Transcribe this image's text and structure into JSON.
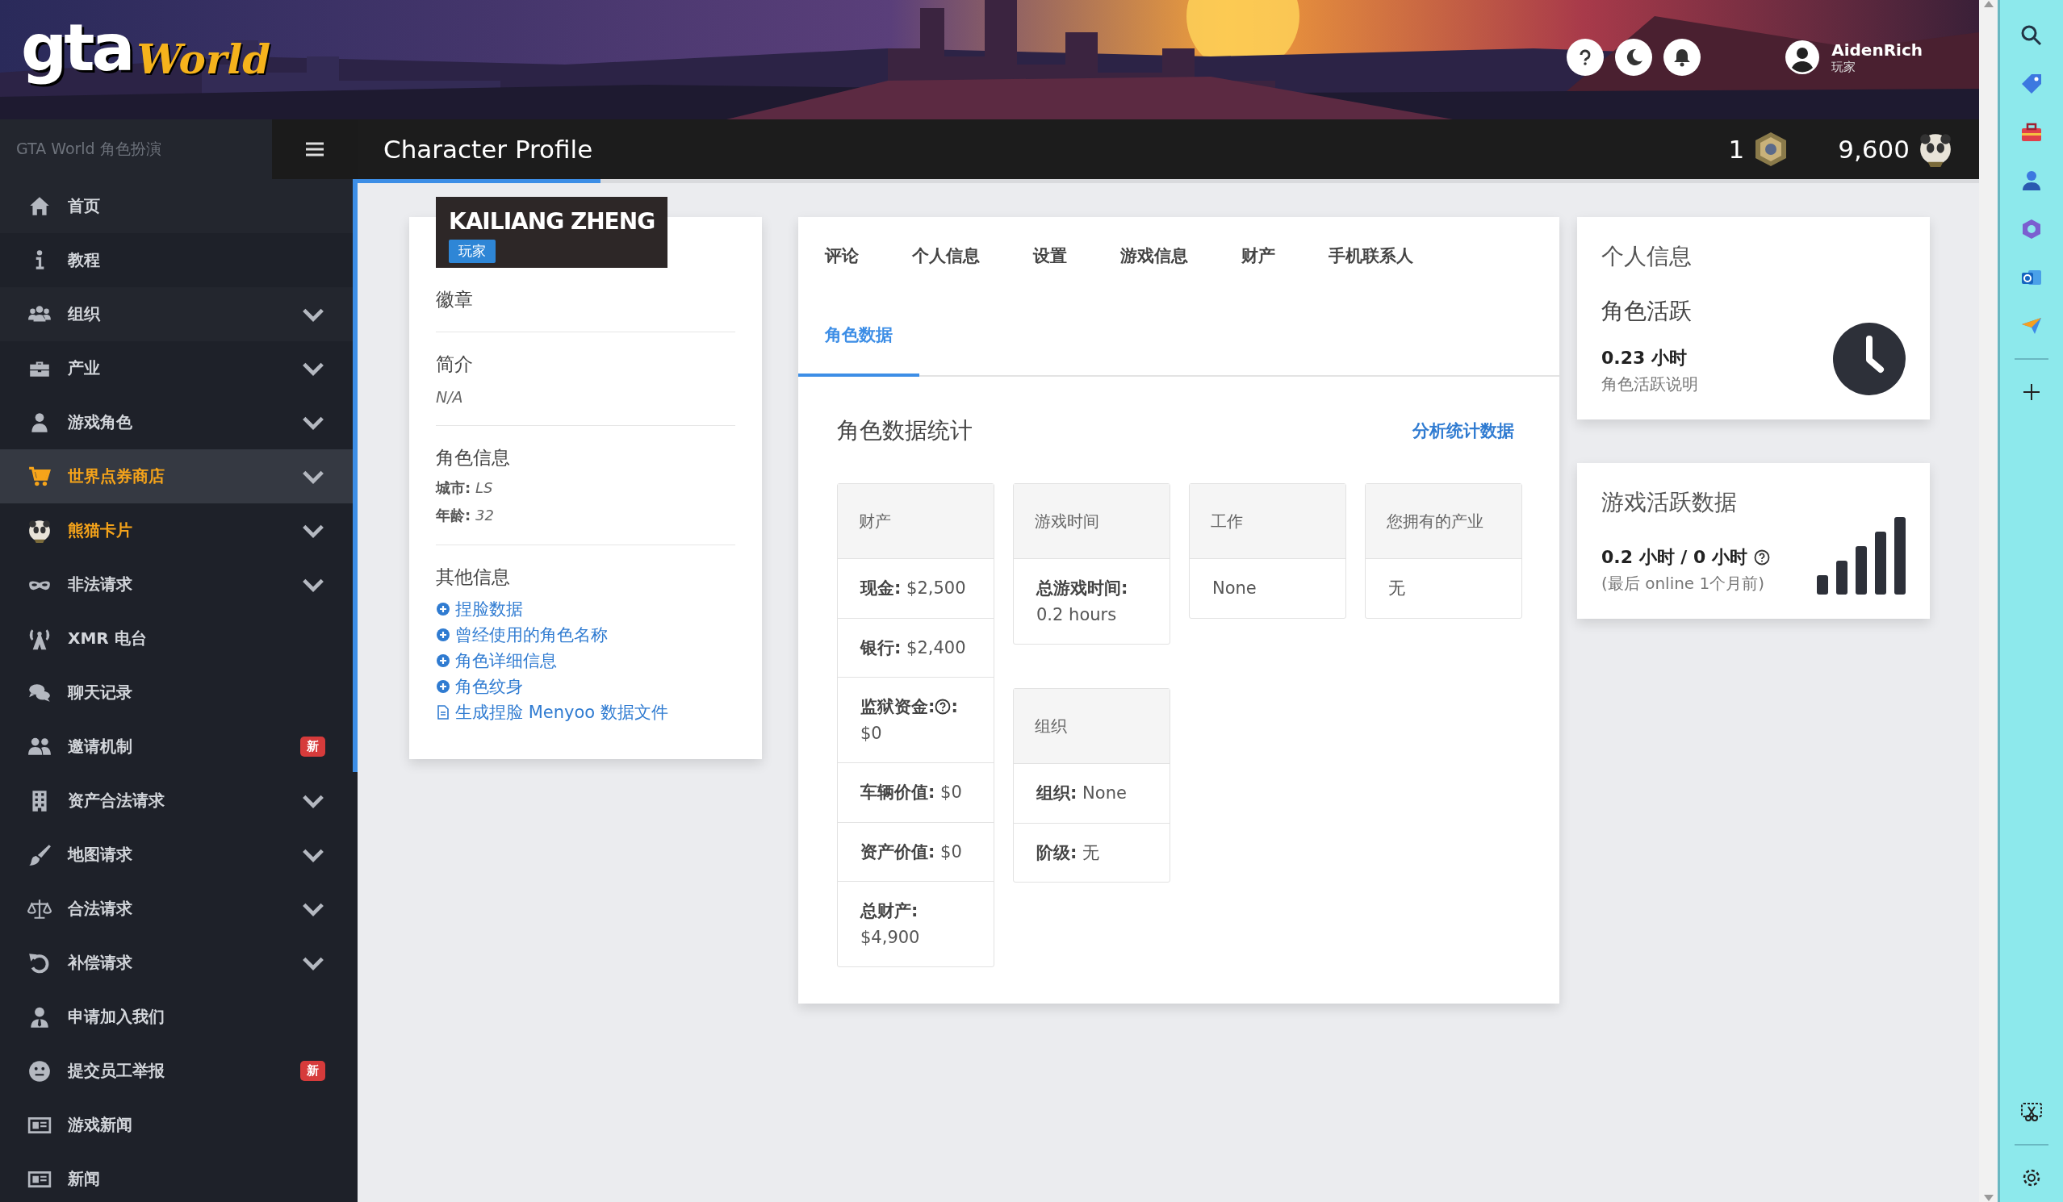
{
  "banner": {
    "logo": {
      "part_1": "gta",
      "part_2": "World"
    },
    "user": {
      "name": "AidenRich",
      "role": "玩家"
    }
  },
  "topbar": {
    "brand": "GTA World 角色扮演",
    "title": "Character Profile",
    "counters": [
      {
        "value": "1"
      },
      {
        "value": "9,600"
      }
    ],
    "loading_bar": {
      "level": 0.15
    }
  },
  "sidebar": {
    "items": [
      {
        "label": "首页",
        "expandable": false,
        "accent": false,
        "selected": false
      },
      {
        "label": "教程",
        "expandable": false,
        "accent": false,
        "selected": false
      },
      {
        "label": "组织",
        "expandable": true,
        "accent": false,
        "selected": false
      },
      {
        "label": "产业",
        "expandable": true,
        "accent": false,
        "selected": false
      },
      {
        "label": "游戏角色",
        "expandable": true,
        "accent": false,
        "selected": false
      },
      {
        "label": "世界点券商店",
        "expandable": true,
        "accent": true,
        "selected": true
      },
      {
        "label": "熊猫卡片",
        "expandable": true,
        "accent": true,
        "selected": false
      },
      {
        "label": "非法请求",
        "expandable": true,
        "accent": false,
        "selected": false
      },
      {
        "label": "XMR 电台",
        "expandable": false,
        "accent": false,
        "selected": false
      },
      {
        "label": "聊天记录",
        "expandable": false,
        "accent": false,
        "selected": false
      },
      {
        "label": "邀请机制",
        "expandable": false,
        "accent": false,
        "selected": false,
        "badge": "新"
      },
      {
        "label": "资产合法请求",
        "expandable": true,
        "accent": false,
        "selected": false
      },
      {
        "label": "地图请求",
        "expandable": true,
        "accent": false,
        "selected": false
      },
      {
        "label": "合法请求",
        "expandable": true,
        "accent": false,
        "selected": false
      },
      {
        "label": "补偿请求",
        "expandable": true,
        "accent": false,
        "selected": false
      },
      {
        "label": "申请加入我们",
        "expandable": false,
        "accent": false,
        "selected": false
      },
      {
        "label": "提交员工举报",
        "expandable": false,
        "accent": false,
        "selected": false,
        "badge": "新"
      },
      {
        "label": "游戏新闻",
        "expandable": false,
        "accent": false,
        "selected": false
      },
      {
        "label": "新闻",
        "expandable": false,
        "accent": false,
        "selected": false
      }
    ]
  },
  "profile": {
    "name": "KAILIANG ZHENG",
    "role": "玩家",
    "badges_title": "徽章",
    "bio_title": "简介",
    "bio": "N/A",
    "info_title": "角色信息",
    "info": [
      {
        "label": "城市:",
        "value": "LS"
      },
      {
        "label": "年龄:",
        "value": "32"
      }
    ],
    "other_title": "其他信息",
    "links": [
      {
        "kind": "expand",
        "text": "捏脸数据"
      },
      {
        "kind": "expand",
        "text": "曾经使用的角色名称"
      },
      {
        "kind": "expand",
        "text": "角色详细信息"
      },
      {
        "kind": "expand",
        "text": "角色纹身"
      },
      {
        "kind": "file",
        "text": "生成捏脸 Menyoo 数据文件"
      }
    ]
  },
  "tabs": [
    {
      "label": "评论",
      "selected": false
    },
    {
      "label": "个人信息",
      "selected": false
    },
    {
      "label": "设置",
      "selected": false
    },
    {
      "label": "游戏信息",
      "selected": false
    },
    {
      "label": "财产",
      "selected": false
    },
    {
      "label": "手机联系人",
      "selected": false
    },
    {
      "label": "角色数据",
      "selected": true
    }
  ],
  "stats": {
    "title": "角色数据统计",
    "link": "分析统计数据",
    "columns": [
      [
        {
          "header": "财产",
          "rows": [
            {
              "label": "现金:",
              "value": "$2,500",
              "stacked": false
            },
            {
              "label": "银行:",
              "value": "$2,400",
              "stacked": false
            },
            {
              "label": "监狱资金:",
              "help": true,
              "suffix": ":",
              "value": "$0",
              "stacked": true
            },
            {
              "label": "车辆价值:",
              "value": "$0",
              "stacked": false
            },
            {
              "label": "资产价值:",
              "value": "$0",
              "stacked": false
            },
            {
              "label": "总财产:",
              "value": "$4,900",
              "stacked": true
            }
          ]
        }
      ],
      [
        {
          "header": "游戏时间",
          "rows": [
            {
              "label": "总游戏时间:",
              "value": "0.2 hours"
            }
          ]
        },
        {
          "header": "组织",
          "rows": [
            {
              "label": "组织:",
              "value": "None",
              "stacked": false
            },
            {
              "label": "阶级:",
              "value": "无",
              "stacked": false
            }
          ]
        }
      ],
      [
        {
          "header": "工作",
          "rows": [
            {
              "value": "None",
              "stacked": false
            }
          ]
        }
      ],
      [
        {
          "header": "您拥有的产业",
          "rows": [
            {
              "value": "无",
              "stacked": false
            }
          ]
        }
      ]
    ]
  },
  "activity": {
    "title": "个人信息",
    "subtitle": "角色活跃",
    "value": "0.23 小时",
    "note": "角色活跃说明"
  },
  "game_activity": {
    "title": "游戏活跃数据",
    "value": "0.2 小时 / 0 小时",
    "note": "(最后 online 1个月前)"
  }
}
